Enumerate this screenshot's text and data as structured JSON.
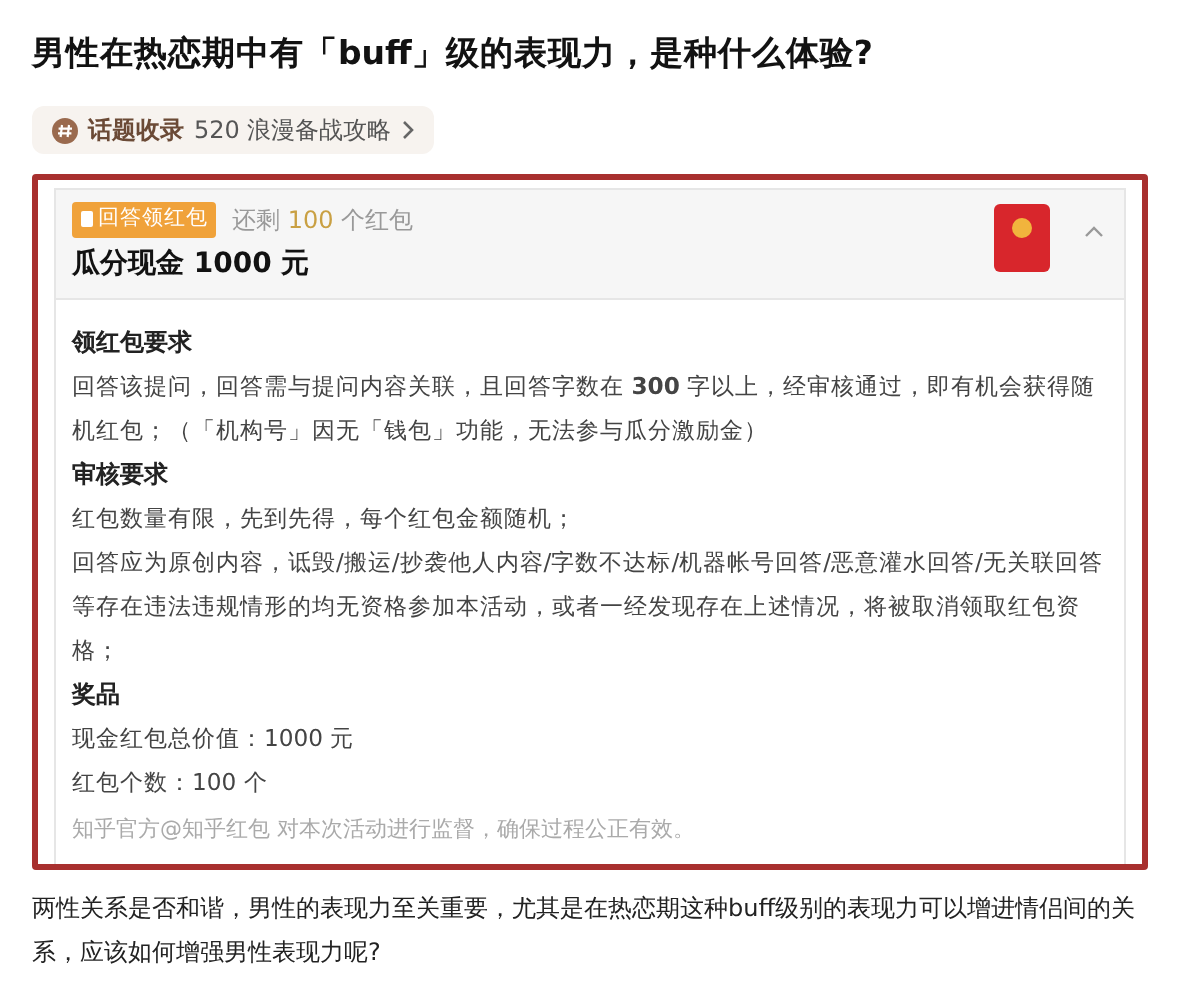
{
  "title": "男性在热恋期中有「buff」级的表现力，是种什么体验?",
  "topic_tag": {
    "label": "话题收录",
    "name": "520 浪漫备战攻略"
  },
  "red_packet": {
    "badge": "回答领红包",
    "remaining": {
      "prefix": "还剩",
      "count": "100",
      "suffix": "个红包"
    },
    "title": "瓜分现金 1000 元",
    "expanded": true,
    "sections": [
      {
        "heading": "领红包要求",
        "paragraphs": [
          "回答该提问，回答需与提问内容关联，且回答字数在 **300** 字以上，经审核通过，即有机会获得随机红包；（「机构号」因无「钱包」功能，无法参与瓜分激励金）"
        ]
      },
      {
        "heading": "审核要求",
        "paragraphs": [
          "红包数量有限，先到先得，每个红包金额随机；",
          "回答应为原创内容，诋毁/搬运/抄袭他人内容/字数不达标/机器帐号回答/恶意灌水回答/无关联回答等存在违法违规情形的均无资格参加本活动，或者一经发现存在上述情况，将被取消领取红包资格；"
        ]
      },
      {
        "heading": "奖品",
        "paragraphs": [
          "现金红包总价值：1000 元",
          "红包个数：100 个"
        ]
      }
    ],
    "footer": "知乎官方@知乎红包 对本次活动进行监督，确保过程公正有效。"
  },
  "intro": "两性关系是否和谐，男性的表现力至关重要，尤其是在热恋期这种buff级别的表现力可以增进情侣间的关系，应该如何增强男性表现力呢?"
}
